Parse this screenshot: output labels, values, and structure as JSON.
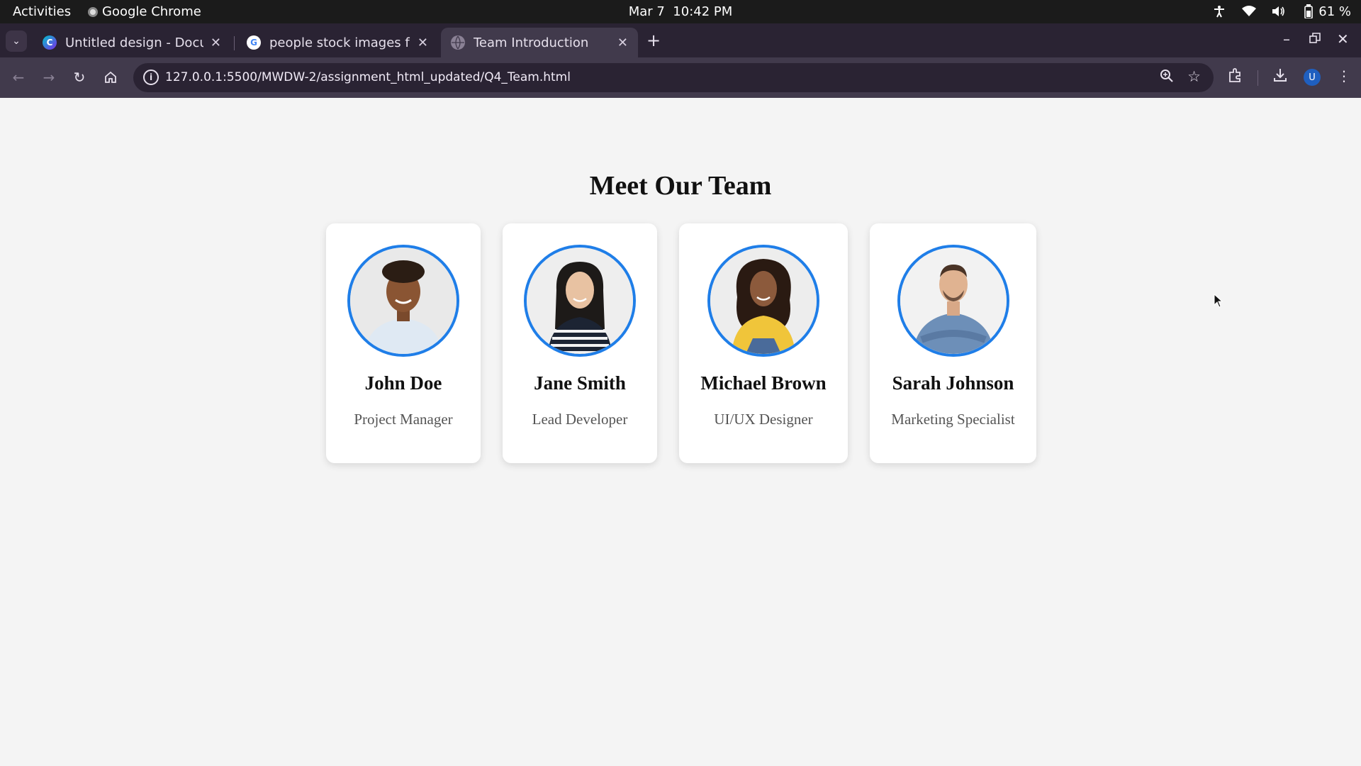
{
  "system_bar": {
    "activities": "Activities",
    "app_name": "Google Chrome",
    "date": "Mar 7",
    "time": "10:42 PM",
    "battery": "61 %"
  },
  "browser": {
    "tabs": [
      {
        "title": "Untitled design - Docume",
        "favicon": "canva-icon",
        "active": false
      },
      {
        "title": "people stock images free",
        "favicon": "google-icon",
        "active": false
      },
      {
        "title": "Team Introduction",
        "favicon": "globe-icon",
        "active": true
      }
    ],
    "url": "127.0.0.1:5500/MWDW-2/assignment_html_updated/Q4_Team.html",
    "profile_initial": "U"
  },
  "page": {
    "heading": "Meet Our Team",
    "members": [
      {
        "name": "John Doe",
        "role": "Project Manager"
      },
      {
        "name": "Jane Smith",
        "role": "Lead Developer"
      },
      {
        "name": "Michael Brown",
        "role": "UI/UX Designer"
      },
      {
        "name": "Sarah Johnson",
        "role": "Marketing Specialist"
      }
    ]
  },
  "colors": {
    "photo_border": "#1f7ee8",
    "page_background": "#f4f4f4",
    "tab_strip": "#2a2333",
    "toolbar": "#413a4c"
  }
}
